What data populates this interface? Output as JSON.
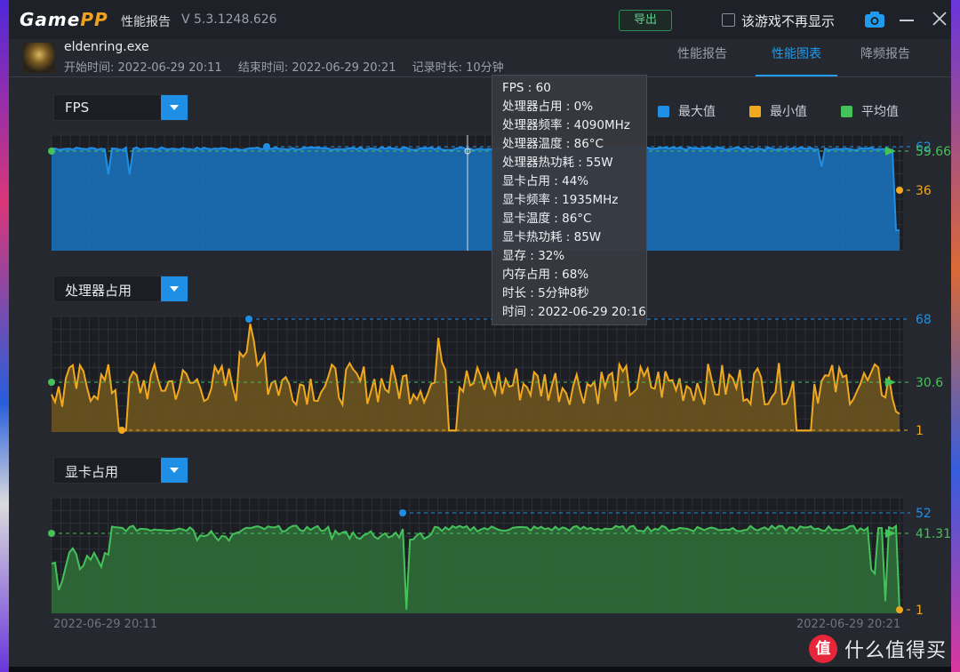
{
  "window": {
    "logo_main": "Game",
    "logo_accent": "PP",
    "title": "性能报告",
    "version": "V 5.3.1248.626",
    "export_label": "导出",
    "checkbox_label": "该游戏不再显示"
  },
  "session": {
    "game_name": "eldenring.exe",
    "start": "开始时间: 2022-06-29 20:11",
    "end": "结束时间: 2022-06-29 20:21",
    "duration": "记录时长: 10分钟"
  },
  "tabs": [
    {
      "label": "性能报告",
      "active": false
    },
    {
      "label": "性能图表",
      "active": true
    },
    {
      "label": "降频报告",
      "active": false
    }
  ],
  "legend": [
    {
      "label": "最大值",
      "color": "#1f8fe6"
    },
    {
      "label": "最小值",
      "color": "#f0a81e"
    },
    {
      "label": "平均值",
      "color": "#45c15a"
    }
  ],
  "charts": [
    {
      "selector": "FPS",
      "max_label": "62",
      "avg_label": "59.66",
      "min_label": "36"
    },
    {
      "selector": "处理器占用",
      "max_label": "68",
      "avg_label": "30.6",
      "min_label": "1"
    },
    {
      "selector": "显卡占用",
      "max_label": "52",
      "avg_label": "41.31",
      "min_label": "1"
    }
  ],
  "tooltip": {
    "lines": [
      "FPS : 60",
      "处理器占用 : 0%",
      "处理器频率 : 4090MHz",
      "处理器温度 : 86°C",
      "处理器热功耗 : 55W",
      "显卡占用 : 44%",
      "显卡频率 : 1935MHz",
      "显卡温度 : 86°C",
      "显卡热功耗 : 85W",
      "显存 : 32%",
      "内存占用 : 68%",
      "时长 : 5分钟8秒",
      "时间 : 2022-06-29 20:16"
    ]
  },
  "x_axis": {
    "start": "2022-06-29 20:11",
    "end": "2022-06-29 20:21"
  },
  "watermark": {
    "badge": "值",
    "text": "什么值得买"
  },
  "colors": {
    "accent": "#1f9cf0",
    "fps": "#1f8fe6",
    "cpu": "#f0a81e",
    "gpu": "#45c15a"
  }
}
